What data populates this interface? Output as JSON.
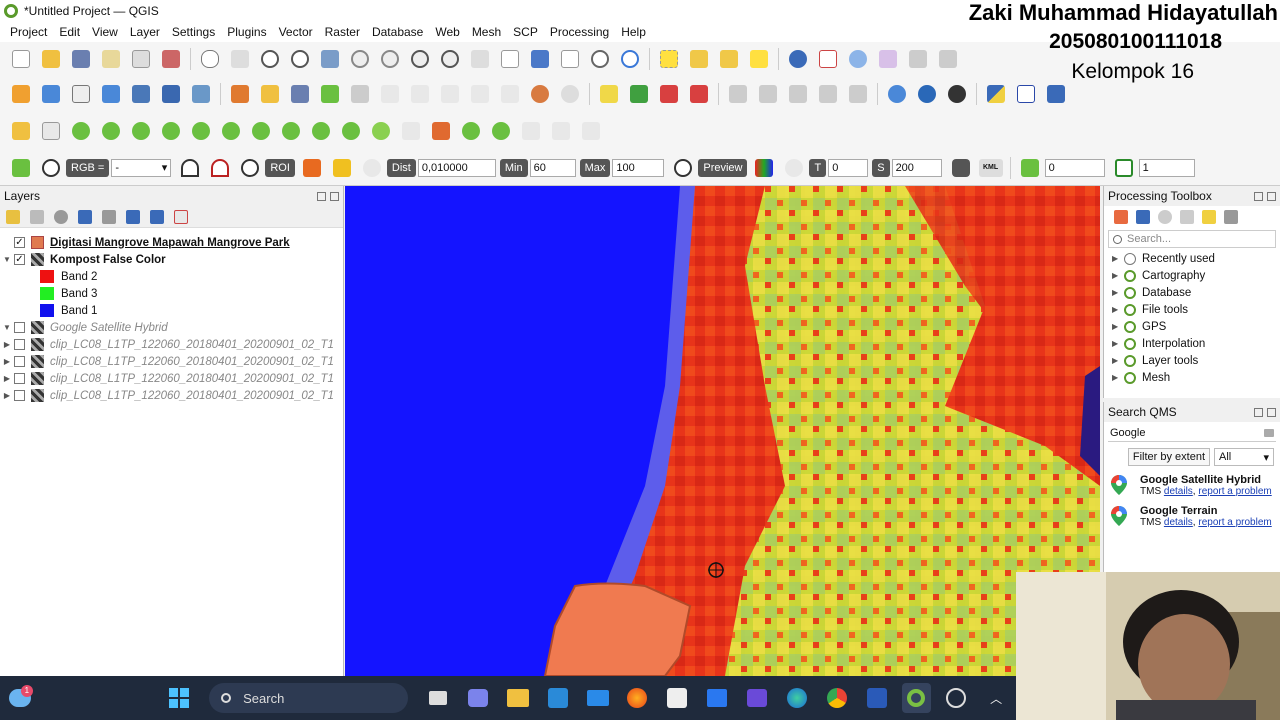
{
  "window": {
    "title": "*Untitled Project — QGIS"
  },
  "menu": [
    "Project",
    "Edit",
    "View",
    "Layer",
    "Settings",
    "Plugins",
    "Vector",
    "Raster",
    "Database",
    "Web",
    "Mesh",
    "SCP",
    "Processing",
    "Help"
  ],
  "overlay": {
    "name": "Zaki Muhammad Hidayatullah",
    "nim": "205080100111018",
    "group": "Kelompok 16"
  },
  "scp_toolbar": {
    "rgb_label": "RGB =",
    "rgb_value": "-",
    "roi_label": "ROI",
    "dist_label": "Dist",
    "dist_value": "0,010000",
    "min_label": "Min",
    "min_value": "60",
    "max_label": "Max",
    "max_value": "100",
    "preview_label": "Preview",
    "t_label": "T",
    "t_value": "0",
    "s_label": "S",
    "s_value": "200",
    "kml_label": "KML",
    "band_value": "0",
    "band2_value": "1"
  },
  "layers_panel": {
    "title": "Layers",
    "items": [
      {
        "name": "Digitasi Mangrove Mapawah Mangrove Park",
        "checked": true,
        "style": "bold-underline"
      },
      {
        "name": "Kompost False Color",
        "checked": true,
        "style": "bold"
      },
      {
        "name": "Band 2",
        "color": "#ee1111"
      },
      {
        "name": "Band 3",
        "color": "#22ee22"
      },
      {
        "name": "Band 1",
        "color": "#1111ee"
      },
      {
        "name": "Google Satellite Hybrid",
        "checked": false,
        "style": "italic"
      },
      {
        "name": "clip_LC08_L1TP_122060_20180401_20200901_02_T1",
        "checked": false,
        "style": "italic"
      },
      {
        "name": "clip_LC08_L1TP_122060_20180401_20200901_02_T1",
        "checked": false,
        "style": "italic"
      },
      {
        "name": "clip_LC08_L1TP_122060_20180401_20200901_02_T1",
        "checked": false,
        "style": "italic"
      },
      {
        "name": "clip_LC08_L1TP_122060_20180401_20200901_02_T1",
        "checked": false,
        "style": "italic"
      }
    ]
  },
  "processing_toolbox": {
    "title": "Processing Toolbox",
    "search_placeholder": "Search...",
    "items": [
      "Recently used",
      "Cartography",
      "Database",
      "File tools",
      "GPS",
      "Interpolation",
      "Layer tools",
      "Mesh"
    ]
  },
  "qms": {
    "title": "Search QMS",
    "query": "Google",
    "filter_button": "Filter by extent",
    "filter_select": "All",
    "results": [
      {
        "title": "Google Satellite Hybrid",
        "type": "TMS",
        "details": "details",
        "report": "report a problem"
      },
      {
        "title": "Google Terrain",
        "type": "TMS",
        "details": "details",
        "report": "report a problem"
      }
    ]
  },
  "taskbar": {
    "search_label": "Search",
    "notification_count": "1"
  },
  "colors": {
    "qgis_green": "#5a9a2b",
    "map_water": "#1010ff",
    "map_red": "#e8301a",
    "polygon": "#f07a50",
    "taskbar": "#1f2a3c"
  }
}
